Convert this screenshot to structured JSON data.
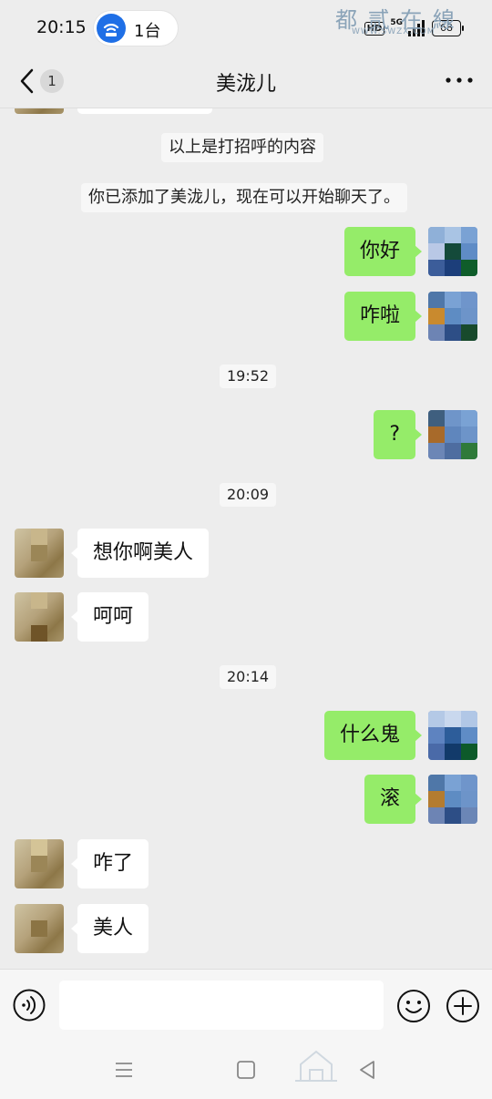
{
  "status_bar": {
    "time": "20:15",
    "pill_text": "1台",
    "network": "5G",
    "battery": "68",
    "icons": [
      "wifi-router-icon",
      "hd-icon",
      "signal-icon",
      "battery-icon"
    ]
  },
  "nav": {
    "unread_count": "1",
    "title": "美泷儿",
    "icons": [
      "back-chevron-icon",
      "more-dots-icon"
    ]
  },
  "messages": {
    "sys_greeting": "以上是打招呼的内容",
    "sys_added": "你已添加了美泷儿，现在可以开始聊天了。",
    "m1": "你好",
    "m2": "咋啦",
    "t1": "19:52",
    "m3": "?",
    "t2": "20:09",
    "m4": "想你啊美人",
    "m5": "呵呵",
    "t3": "20:14",
    "m6": "什么鬼",
    "m7": "滚",
    "m8": "咋了",
    "m9": "美人"
  },
  "input": {
    "value": "",
    "placeholder": "",
    "icons": [
      "voice-icon",
      "emoji-icon",
      "plus-icon"
    ]
  },
  "system_nav": {
    "icons": [
      "menu-icon",
      "home-icon",
      "back-triangle-icon"
    ]
  },
  "watermark": {
    "text": "都 贰 在 線",
    "sub": "WWW.SWZX.COM"
  },
  "colors": {
    "background": "#ededed",
    "my_bubble": "#95ec69",
    "other_bubble": "#ffffff",
    "accent_blue": "#1f6fe6"
  }
}
